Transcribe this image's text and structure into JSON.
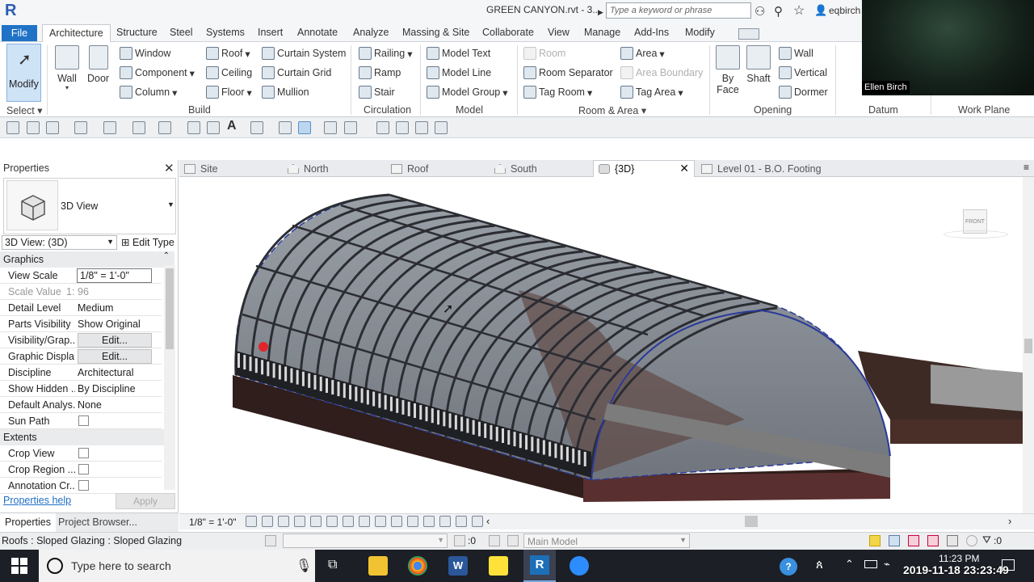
{
  "app": {
    "logo_letter": "R",
    "title": "GREEN CANYON.rvt - 3...",
    "search_placeholder": "Type a keyword or phrase",
    "user": "eqbirch"
  },
  "webcam": {
    "name": "Ellen Birch"
  },
  "ribbon": {
    "tabs": [
      "File",
      "Architecture",
      "Structure",
      "Steel",
      "Systems",
      "Insert",
      "Annotate",
      "Analyze",
      "Massing & Site",
      "Collaborate",
      "View",
      "Manage",
      "Add-Ins",
      "Modify"
    ],
    "select": {
      "modify": "Modify",
      "select": "Select"
    },
    "build": {
      "label": "Build",
      "wall": "Wall",
      "door": "Door",
      "window": "Window",
      "component": "Component",
      "column": "Column",
      "roof": "Roof",
      "ceiling": "Ceiling",
      "floor": "Floor",
      "curtain_system": "Curtain System",
      "curtain_grid": "Curtain Grid",
      "mullion": "Mullion"
    },
    "circulation": {
      "label": "Circulation",
      "railing": "Railing",
      "ramp": "Ramp",
      "stair": "Stair"
    },
    "model": {
      "label": "Model",
      "model_text": "Model Text",
      "model_line": "Model Line",
      "model_group": "Model Group"
    },
    "room_area": {
      "label": "Room & Area",
      "room": "Room",
      "room_separator": "Room Separator",
      "tag_room": "Tag Room",
      "area": "Area",
      "area_boundary": "Area Boundary",
      "tag_area": "Tag Area"
    },
    "opening": {
      "label": "Opening",
      "by_face": "By\nFace",
      "by_face_1": "By",
      "by_face_2": "Face",
      "shaft": "Shaft",
      "wall": "Wall",
      "vertical": "Vertical",
      "dormer": "Dormer"
    },
    "datum": {
      "label": "Datum"
    },
    "work_plane": {
      "label": "Work Plane"
    }
  },
  "properties": {
    "title": "Properties",
    "type_name": "3D View",
    "selector": "3D View: (3D)",
    "edit_type": "Edit Type",
    "sections": {
      "graphics": "Graphics",
      "extents": "Extents"
    },
    "rows": [
      {
        "label": "View Scale",
        "value": "1/8\" = 1'-0\""
      },
      {
        "label": "Scale Value",
        "prefix": "1:",
        "value": "96"
      },
      {
        "label": "Detail Level",
        "value": "Medium"
      },
      {
        "label": "Parts Visibility",
        "value": "Show Original"
      },
      {
        "label": "Visibility/Grap...",
        "value": "Edit..."
      },
      {
        "label": "Graphic Displa...",
        "value": "Edit..."
      },
      {
        "label": "Discipline",
        "value": "Architectural"
      },
      {
        "label": "Show Hidden ...",
        "value": "By Discipline"
      },
      {
        "label": "Default Analys...",
        "value": "None"
      },
      {
        "label": "Sun Path",
        "value": ""
      },
      {
        "label": "Crop View",
        "value": ""
      },
      {
        "label": "Crop Region ...",
        "value": ""
      },
      {
        "label": "Annotation Cr...",
        "value": ""
      }
    ],
    "help": "Properties help",
    "apply": "Apply",
    "bottom_tabs": [
      "Properties",
      "Project Browser..."
    ]
  },
  "view_tabs": [
    {
      "label": "Site"
    },
    {
      "label": "North"
    },
    {
      "label": "Roof"
    },
    {
      "label": "South"
    },
    {
      "label": "{3D}",
      "active": true
    },
    {
      "label": "Level 01 - B.O. Footing"
    }
  ],
  "viewcube": {
    "face": "FRONT"
  },
  "view_control": {
    "scale": "1/8\" = 1'-0\""
  },
  "status": {
    "selection": "Roofs : Sloped Glazing : Sloped Glazing",
    "count": ":0",
    "model": "Main Model",
    "filter_count": ":0"
  },
  "taskbar": {
    "search_placeholder": "Type here to search",
    "time": "11:23 PM",
    "date": "2019-11-18  23:23:49"
  },
  "colors": {
    "file_tab": "#1f72c6",
    "glazing": "#8a8f96",
    "mullion": "#2b2d33",
    "foundation": "#3a2420",
    "selection": "#2a3a9a"
  }
}
